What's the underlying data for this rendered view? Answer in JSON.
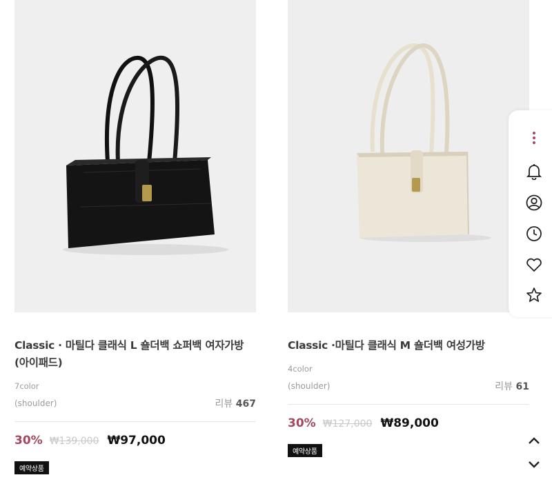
{
  "products": [
    {
      "title": "Classic · 마틸다 클래식 L 숄더백 쇼퍼백 여자가방 (아이패드)",
      "colors": "7color",
      "category": "(shoulder)",
      "review_label": "리뷰",
      "review_count": "467",
      "discount": "30%",
      "original_price": "₩139,000",
      "price": "₩97,000",
      "badge": "예약상품",
      "bag_color": "#141414"
    },
    {
      "title": "Classic ·마틸다 클래식 M 숄더백 여성가방",
      "colors": "4color",
      "category": "(shoulder)",
      "review_label": "리뷰",
      "review_count": "61",
      "discount": "30%",
      "original_price": "₩127,000",
      "price": "₩89,000",
      "badge": "예약상품",
      "bag_color": "#ece6d8"
    }
  ],
  "side_panel": {
    "icons": [
      "more-vertical-icon",
      "bell-icon",
      "user-icon",
      "clock-icon",
      "heart-icon",
      "star-icon"
    ]
  },
  "scroll": {
    "up": "chevron-up-icon",
    "down": "chevron-down-icon"
  },
  "colors": {
    "accent": "#a2475e",
    "more_dots": "#a2475e"
  }
}
